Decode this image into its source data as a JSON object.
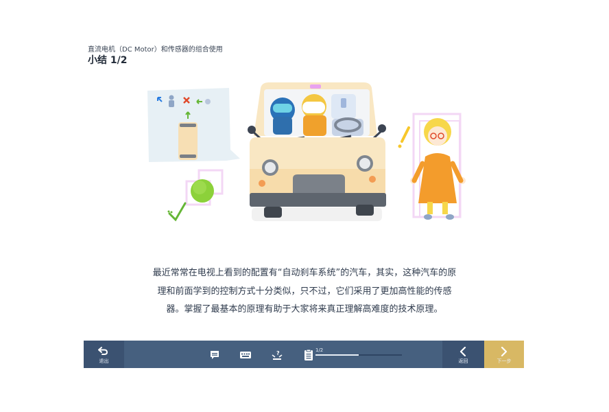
{
  "header": {
    "breadcrumb": "直流电机（DC Motor）和传感器的组合使用",
    "title": "小结 1/2"
  },
  "illustration": {
    "icon": "car-auto-brake-illustration"
  },
  "body": {
    "lines": [
      "最近常常在电视上看到的配置有“自动刹车系统”的汽车，其实，这种汽车的原",
      "理和前面学到的控制方式十分类似，只不过，它们采用了更加高性能的传感",
      "器。掌握了最基本的原理有助于大家将来真正理解高难度的技术原理。"
    ]
  },
  "toolbar": {
    "exit_label": "退出",
    "back_label": "返回",
    "next_label": "下一步",
    "progress_text": "1/2",
    "progress_fraction": 0.5,
    "tools": [
      "comment-icon",
      "keyboard-icon",
      "hint-icon",
      "notes-icon"
    ]
  },
  "colors": {
    "toolbar_bg": "#46607f",
    "toolbar_dark": "#3b5271",
    "next_accent": "#d8b864",
    "car_body": "#f9e7c3",
    "text": "#2f3b4d"
  }
}
